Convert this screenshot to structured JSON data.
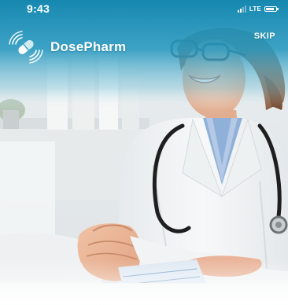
{
  "status_bar": {
    "time": "9:43",
    "network": "LTE",
    "signal_bars_active": 2,
    "signal_bars_total": 4,
    "battery_level": 0.85
  },
  "header": {
    "brand_name": "DosePharm",
    "logo_icon": "pill-signal-icon",
    "skip_label": "SKIP"
  },
  "hero": {
    "image": "doctor-holding-patient-hands-photo"
  },
  "colors": {
    "header_teal": "#1a92b8",
    "header_teal_light": "#55b7d3",
    "text_on_header": "#ffffff",
    "coat_white": "#f4f6f7",
    "shirt_blue": "#8fb0d8"
  }
}
